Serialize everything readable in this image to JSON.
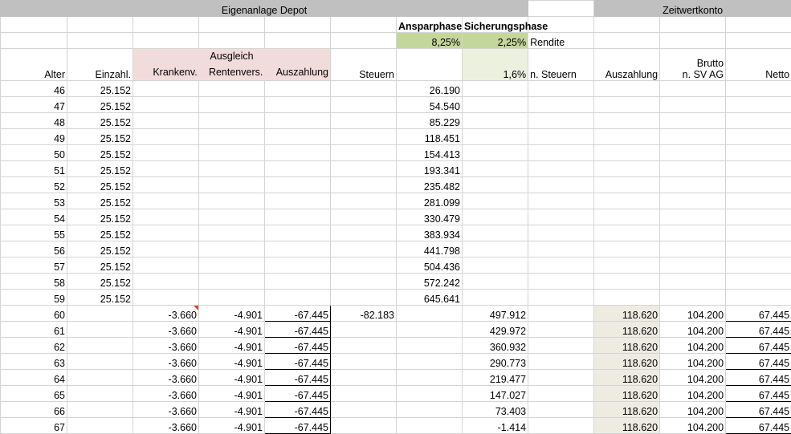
{
  "header": {
    "depot_title": "Eigenanlage Depot",
    "zwk_title": "Zeitwertkonto",
    "ansparphase": "Ansparphase",
    "sicherungsphase": "Sicherungsphase",
    "rendite_anspar": "8,25%",
    "rendite_sicherung": "2,25%",
    "rendite_label": "Rendite",
    "steuer_rate": "1,6%",
    "n_steuern_label": "n. Steuern"
  },
  "columns": {
    "alter": "Alter",
    "einzahl": "Einzahl.",
    "ausgleich": "Ausgleich",
    "krankenv": "Krankenv.",
    "rentenvers": "Rentenvers.",
    "auszahlung": "Auszahlung",
    "steuern": "Steuern",
    "zwk_auszahlung": "Auszahlung",
    "brutto": "Brutto",
    "n_sv_ag": "n. SV AG",
    "netto": "Netto"
  },
  "rows": [
    [
      "46",
      "25.152",
      "",
      "",
      "",
      "",
      "26.190",
      "",
      "",
      "",
      "",
      ""
    ],
    [
      "47",
      "25.152",
      "",
      "",
      "",
      "",
      "54.540",
      "",
      "",
      "",
      "",
      ""
    ],
    [
      "48",
      "25.152",
      "",
      "",
      "",
      "",
      "85.229",
      "",
      "",
      "",
      "",
      ""
    ],
    [
      "49",
      "25.152",
      "",
      "",
      "",
      "",
      "118.451",
      "",
      "",
      "",
      "",
      ""
    ],
    [
      "50",
      "25.152",
      "",
      "",
      "",
      "",
      "154.413",
      "",
      "",
      "",
      "",
      ""
    ],
    [
      "51",
      "25.152",
      "",
      "",
      "",
      "",
      "193.341",
      "",
      "",
      "",
      "",
      ""
    ],
    [
      "52",
      "25.152",
      "",
      "",
      "",
      "",
      "235.482",
      "",
      "",
      "",
      "",
      ""
    ],
    [
      "53",
      "25.152",
      "",
      "",
      "",
      "",
      "281.099",
      "",
      "",
      "",
      "",
      ""
    ],
    [
      "54",
      "25.152",
      "",
      "",
      "",
      "",
      "330.479",
      "",
      "",
      "",
      "",
      ""
    ],
    [
      "55",
      "25.152",
      "",
      "",
      "",
      "",
      "383.934",
      "",
      "",
      "",
      "",
      ""
    ],
    [
      "56",
      "25.152",
      "",
      "",
      "",
      "",
      "441.798",
      "",
      "",
      "",
      "",
      ""
    ],
    [
      "57",
      "25.152",
      "",
      "",
      "",
      "",
      "504.436",
      "",
      "",
      "",
      "",
      ""
    ],
    [
      "58",
      "25.152",
      "",
      "",
      "",
      "",
      "572.242",
      "",
      "",
      "",
      "",
      ""
    ],
    [
      "59",
      "25.152",
      "",
      "",
      "",
      "",
      "645.641",
      "",
      "",
      "",
      "",
      ""
    ],
    [
      "60",
      "",
      "-3.660",
      "-4.901",
      "-67.445",
      "-82.183",
      "",
      "497.912",
      "",
      "118.620",
      "104.200",
      "67.445"
    ],
    [
      "61",
      "",
      "-3.660",
      "-4.901",
      "-67.445",
      "",
      "",
      "429.972",
      "",
      "118.620",
      "104.200",
      "67.445"
    ],
    [
      "62",
      "",
      "-3.660",
      "-4.901",
      "-67.445",
      "",
      "",
      "360.932",
      "",
      "118.620",
      "104.200",
      "67.445"
    ],
    [
      "63",
      "",
      "-3.660",
      "-4.901",
      "-67.445",
      "",
      "",
      "290.773",
      "",
      "118.620",
      "104.200",
      "67.445"
    ],
    [
      "64",
      "",
      "-3.660",
      "-4.901",
      "-67.445",
      "",
      "",
      "219.477",
      "",
      "118.620",
      "104.200",
      "67.445"
    ],
    [
      "65",
      "",
      "-3.660",
      "-4.901",
      "-67.445",
      "",
      "",
      "147.027",
      "",
      "118.620",
      "104.200",
      "67.445"
    ],
    [
      "66",
      "",
      "-3.660",
      "-4.901",
      "-67.445",
      "",
      "",
      "73.403",
      "",
      "118.620",
      "104.200",
      "67.445"
    ],
    [
      "67",
      "",
      "-3.660",
      "-4.901",
      "-67.445",
      "",
      "",
      "-1.414",
      "",
      "118.620",
      "104.200",
      "67.445"
    ]
  ]
}
